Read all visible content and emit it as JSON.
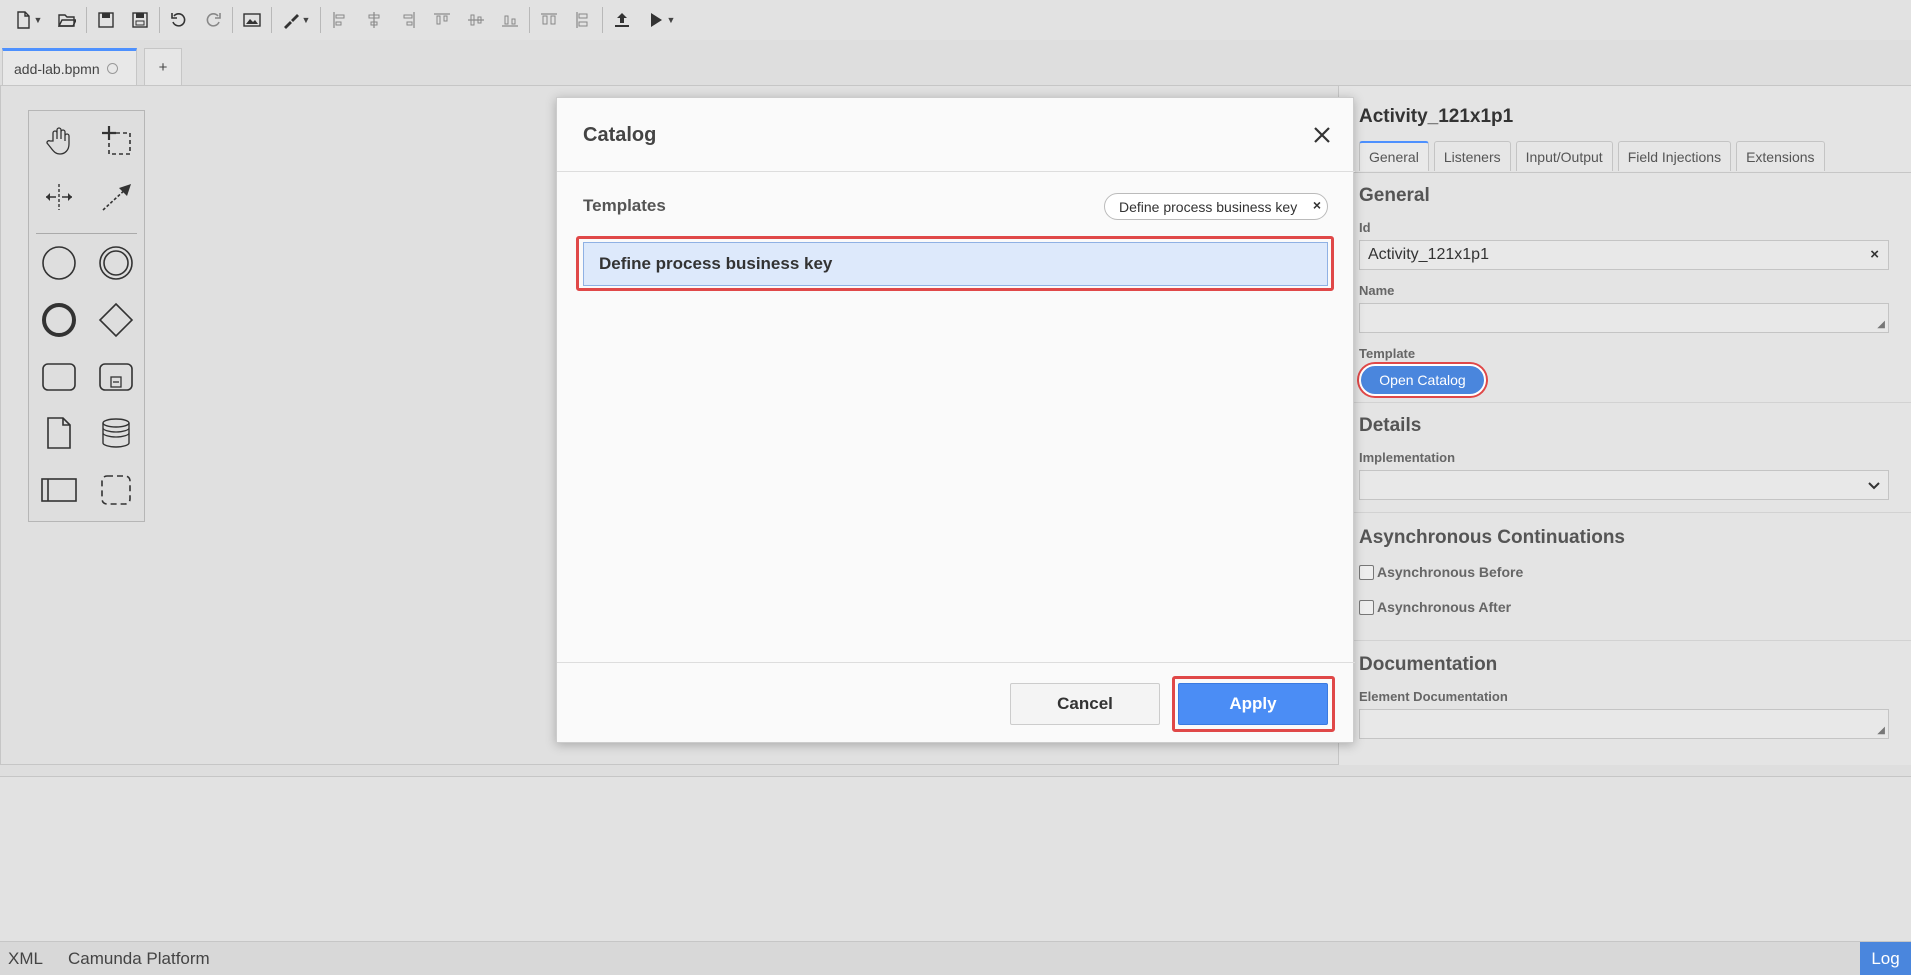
{
  "toolbar": {
    "buttons": [
      "new-file-icon",
      "open-folder-icon",
      "save-icon",
      "save-as-icon",
      "undo-icon",
      "redo-icon",
      "export-image-icon",
      "color-picker-icon",
      "align-left-icon",
      "align-center-icon",
      "align-right-icon",
      "align-top-icon",
      "align-middle-icon",
      "align-bottom-icon",
      "distribute-horizontal-icon",
      "distribute-vertical-icon",
      "deploy-icon",
      "start-instance-icon"
    ]
  },
  "tabs": {
    "active_label": "add-lab.bpmn",
    "add_label": "+"
  },
  "palette": {
    "tools": [
      "hand-tool",
      "lasso-tool",
      "space-tool",
      "connect-tool",
      "start-event",
      "intermediate-event",
      "end-event",
      "gateway",
      "task",
      "subprocess",
      "data-object",
      "data-store",
      "pool",
      "group"
    ]
  },
  "modal": {
    "title": "Catalog",
    "templates_label": "Templates",
    "filter_text": "Define process business key",
    "filter_clear": "×",
    "template_item": "Define process business key",
    "cancel_label": "Cancel",
    "apply_label": "Apply"
  },
  "properties": {
    "title": "Activity_121x1p1",
    "tabs": [
      "General",
      "Listeners",
      "Input/Output",
      "Field Injections",
      "Extensions"
    ],
    "general": {
      "heading": "General",
      "id_label": "Id",
      "id_value": "Activity_121x1p1",
      "id_clear": "×",
      "name_label": "Name",
      "name_value": "",
      "template_label": "Template",
      "open_catalog": "Open Catalog"
    },
    "details": {
      "heading": "Details",
      "implementation_label": "Implementation",
      "implementation_value": ""
    },
    "async": {
      "heading": "Asynchronous Continuations",
      "before_label": "Asynchronous Before",
      "after_label": "Asynchronous After"
    },
    "documentation": {
      "heading": "Documentation",
      "element_doc_label": "Element Documentation",
      "element_doc_value": ""
    }
  },
  "status_bar": {
    "xml": "XML",
    "platform": "Camunda Platform",
    "log": "Log"
  },
  "colors": {
    "accent": "#4b8df5",
    "highlight": "#e04848",
    "selected_item_bg": "#dde9fb"
  }
}
